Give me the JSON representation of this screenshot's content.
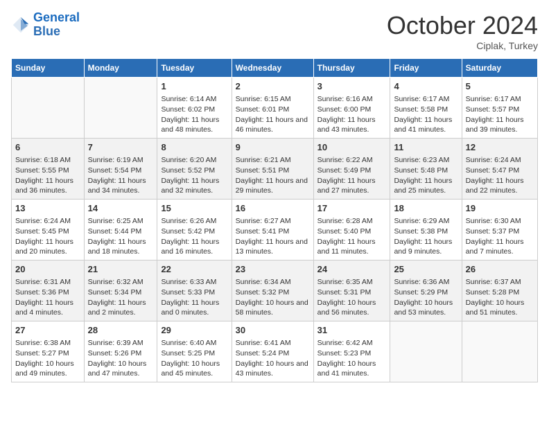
{
  "logo": {
    "line1": "General",
    "line2": "Blue"
  },
  "title": "October 2024",
  "subtitle": "Ciplak, Turkey",
  "days_of_week": [
    "Sunday",
    "Monday",
    "Tuesday",
    "Wednesday",
    "Thursday",
    "Friday",
    "Saturday"
  ],
  "weeks": [
    [
      null,
      null,
      {
        "day": 1,
        "sunrise": "6:14 AM",
        "sunset": "6:02 PM",
        "daylight": "11 hours and 48 minutes."
      },
      {
        "day": 2,
        "sunrise": "6:15 AM",
        "sunset": "6:01 PM",
        "daylight": "11 hours and 46 minutes."
      },
      {
        "day": 3,
        "sunrise": "6:16 AM",
        "sunset": "6:00 PM",
        "daylight": "11 hours and 43 minutes."
      },
      {
        "day": 4,
        "sunrise": "6:17 AM",
        "sunset": "5:58 PM",
        "daylight": "11 hours and 41 minutes."
      },
      {
        "day": 5,
        "sunrise": "6:17 AM",
        "sunset": "5:57 PM",
        "daylight": "11 hours and 39 minutes."
      }
    ],
    [
      {
        "day": 6,
        "sunrise": "6:18 AM",
        "sunset": "5:55 PM",
        "daylight": "11 hours and 36 minutes."
      },
      {
        "day": 7,
        "sunrise": "6:19 AM",
        "sunset": "5:54 PM",
        "daylight": "11 hours and 34 minutes."
      },
      {
        "day": 8,
        "sunrise": "6:20 AM",
        "sunset": "5:52 PM",
        "daylight": "11 hours and 32 minutes."
      },
      {
        "day": 9,
        "sunrise": "6:21 AM",
        "sunset": "5:51 PM",
        "daylight": "11 hours and 29 minutes."
      },
      {
        "day": 10,
        "sunrise": "6:22 AM",
        "sunset": "5:49 PM",
        "daylight": "11 hours and 27 minutes."
      },
      {
        "day": 11,
        "sunrise": "6:23 AM",
        "sunset": "5:48 PM",
        "daylight": "11 hours and 25 minutes."
      },
      {
        "day": 12,
        "sunrise": "6:24 AM",
        "sunset": "5:47 PM",
        "daylight": "11 hours and 22 minutes."
      }
    ],
    [
      {
        "day": 13,
        "sunrise": "6:24 AM",
        "sunset": "5:45 PM",
        "daylight": "11 hours and 20 minutes."
      },
      {
        "day": 14,
        "sunrise": "6:25 AM",
        "sunset": "5:44 PM",
        "daylight": "11 hours and 18 minutes."
      },
      {
        "day": 15,
        "sunrise": "6:26 AM",
        "sunset": "5:42 PM",
        "daylight": "11 hours and 16 minutes."
      },
      {
        "day": 16,
        "sunrise": "6:27 AM",
        "sunset": "5:41 PM",
        "daylight": "11 hours and 13 minutes."
      },
      {
        "day": 17,
        "sunrise": "6:28 AM",
        "sunset": "5:40 PM",
        "daylight": "11 hours and 11 minutes."
      },
      {
        "day": 18,
        "sunrise": "6:29 AM",
        "sunset": "5:38 PM",
        "daylight": "11 hours and 9 minutes."
      },
      {
        "day": 19,
        "sunrise": "6:30 AM",
        "sunset": "5:37 PM",
        "daylight": "11 hours and 7 minutes."
      }
    ],
    [
      {
        "day": 20,
        "sunrise": "6:31 AM",
        "sunset": "5:36 PM",
        "daylight": "11 hours and 4 minutes."
      },
      {
        "day": 21,
        "sunrise": "6:32 AM",
        "sunset": "5:34 PM",
        "daylight": "11 hours and 2 minutes."
      },
      {
        "day": 22,
        "sunrise": "6:33 AM",
        "sunset": "5:33 PM",
        "daylight": "11 hours and 0 minutes."
      },
      {
        "day": 23,
        "sunrise": "6:34 AM",
        "sunset": "5:32 PM",
        "daylight": "10 hours and 58 minutes."
      },
      {
        "day": 24,
        "sunrise": "6:35 AM",
        "sunset": "5:31 PM",
        "daylight": "10 hours and 56 minutes."
      },
      {
        "day": 25,
        "sunrise": "6:36 AM",
        "sunset": "5:29 PM",
        "daylight": "10 hours and 53 minutes."
      },
      {
        "day": 26,
        "sunrise": "6:37 AM",
        "sunset": "5:28 PM",
        "daylight": "10 hours and 51 minutes."
      }
    ],
    [
      {
        "day": 27,
        "sunrise": "6:38 AM",
        "sunset": "5:27 PM",
        "daylight": "10 hours and 49 minutes."
      },
      {
        "day": 28,
        "sunrise": "6:39 AM",
        "sunset": "5:26 PM",
        "daylight": "10 hours and 47 minutes."
      },
      {
        "day": 29,
        "sunrise": "6:40 AM",
        "sunset": "5:25 PM",
        "daylight": "10 hours and 45 minutes."
      },
      {
        "day": 30,
        "sunrise": "6:41 AM",
        "sunset": "5:24 PM",
        "daylight": "10 hours and 43 minutes."
      },
      {
        "day": 31,
        "sunrise": "6:42 AM",
        "sunset": "5:23 PM",
        "daylight": "10 hours and 41 minutes."
      },
      null,
      null
    ]
  ]
}
